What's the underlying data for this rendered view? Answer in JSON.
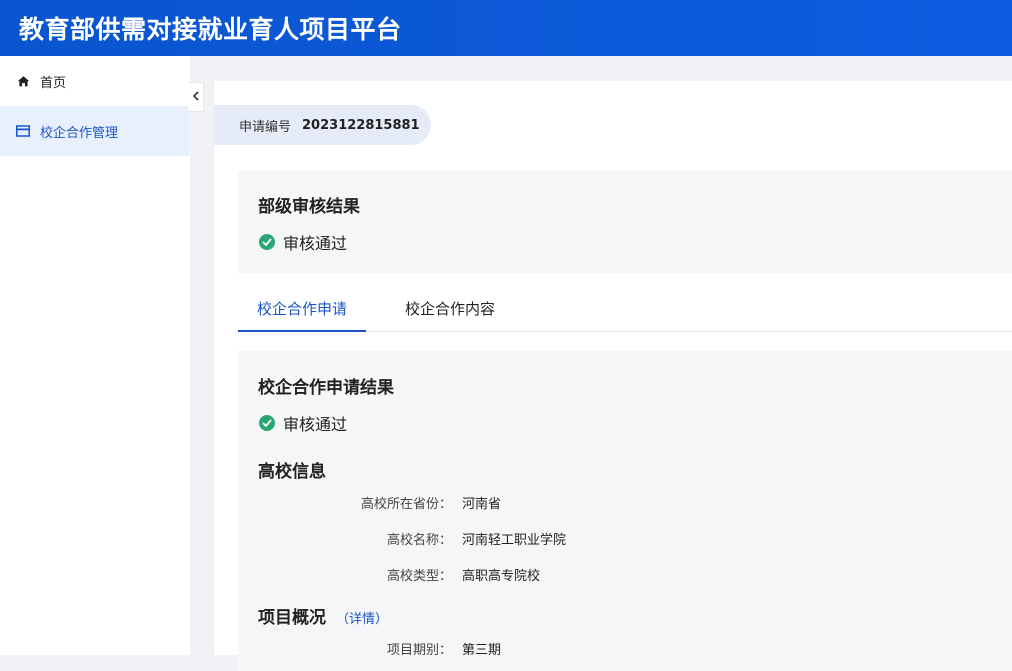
{
  "header": {
    "title": "教育部供需对接就业育人项目平台"
  },
  "sidebar": {
    "items": [
      {
        "label": "首页",
        "icon": "home-icon"
      },
      {
        "label": "校企合作管理",
        "icon": "card-icon",
        "active": true
      }
    ],
    "collapse_icon": "chevron-left-icon"
  },
  "application": {
    "label": "申请编号",
    "number": "2023122815881"
  },
  "ministry_review": {
    "title": "部级审核结果",
    "status": "审核通过"
  },
  "tabs": [
    {
      "label": "校企合作申请",
      "active": true
    },
    {
      "label": "校企合作内容",
      "active": false
    }
  ],
  "application_result": {
    "title": "校企合作申请结果",
    "status": "审核通过"
  },
  "school_info": {
    "title": "高校信息",
    "fields": [
      {
        "label": "高校所在省份：",
        "value": "河南省"
      },
      {
        "label": "高校名称：",
        "value": "河南轻工职业学院"
      },
      {
        "label": "高校类型：",
        "value": "高职高专院校"
      }
    ]
  },
  "project_overview": {
    "title": "项目概况",
    "detail_link": "（详情）",
    "fields": [
      {
        "label": "项目期别：",
        "value": "第三期"
      }
    ]
  },
  "colors": {
    "header_bg": "#0b57d0",
    "accent": "#1a56c8",
    "success": "#2aa574",
    "active_bg": "#e8f0fe"
  }
}
